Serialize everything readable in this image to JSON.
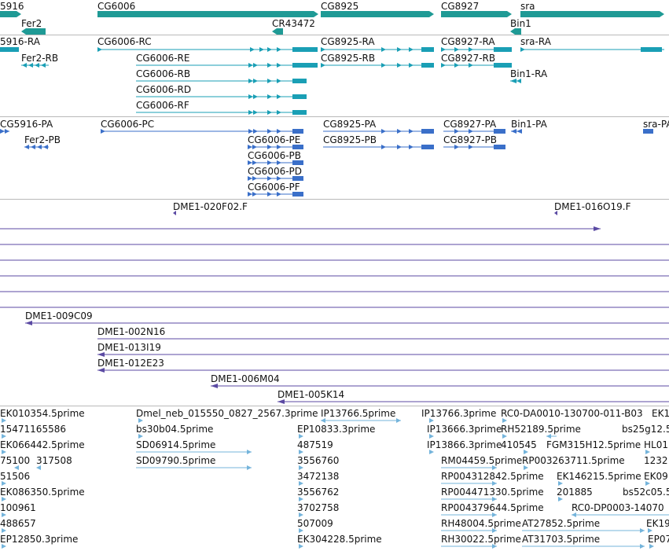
{
  "colors": {
    "gene": "#1f9a95",
    "transcript": "#1a9fb5",
    "protein": "#3a6fc9",
    "clone": "#5b4aa3",
    "est": "#74b4db",
    "separator": "#b9b9b9"
  },
  "tracks": {
    "genes": {
      "labels": [
        "5916",
        "Fer2",
        "CG6006",
        "CR43472",
        "CG8925",
        "CG8927",
        "Bin1",
        "sra"
      ]
    },
    "transcripts": {
      "labels": [
        "5916-RA",
        "Fer2-RB",
        "CG6006-RC",
        "CG6006-RE",
        "CG6006-RB",
        "CG6006-RD",
        "CG6006-RF",
        "CG8925-RA",
        "CG8925-RB",
        "CG8927-RA",
        "CG8927-RB",
        "sra-RA",
        "Bin1-RA"
      ]
    },
    "proteins": {
      "labels": [
        "CG5916-PA",
        "Fer2-PB",
        "CG6006-PC",
        "CG6006-PE",
        "CG6006-PB",
        "CG6006-PD",
        "CG6006-PF",
        "CG8925-PA",
        "CG8925-PB",
        "CG8927-PA",
        "CG8927-PB",
        "Bin1-PA",
        "sra-PA"
      ]
    },
    "clones": {
      "labels": [
        "DME1-020F02.F",
        "DME1-016O19.F",
        "DME1-009C09",
        "DME1-002N16",
        "DME1-013I19",
        "DME1-012E23",
        "DME1-006M04",
        "DME1-005K14"
      ]
    },
    "ests": {
      "labels": [
        "EK010354.5prime",
        "15471165586",
        "EK066442.5prime",
        "75100",
        "317508",
        "51506",
        "EK086350.5prime",
        "100961",
        "488657",
        "EP12850.3prime",
        "Dmel_neb_015550_0827_2567.3prime",
        "bs30b04.5prime",
        "SD06914.5prime",
        "SD09790.5prime",
        "IP13766.5prime",
        "EP10833.3prime",
        "487519",
        "3556760",
        "3472138",
        "3556762",
        "3702758",
        "507009",
        "EK304228.5prime",
        "IP13766.3prime",
        "IP13666.3prime",
        "IP13866.3prime",
        "RM04459.5prime",
        "RP004312842.5prime",
        "RP004471330.5prime",
        "RP004379644.5prime",
        "RH48004.5prime",
        "RH30022.5prime",
        "RC0-DA0010-130700-011-B03",
        "RH52189.5prime",
        "410545",
        "FGM315H12.5prime",
        "RP003263711.5prime",
        "EK146215.5prime",
        "201885",
        "RC0-DP0003-14070",
        "AT27852.5prime",
        "AT31703.5prime",
        "EK1",
        "bs25g12.5",
        "HL01",
        "1232",
        "EK09",
        "bs52c05.5",
        "EK19",
        "EP07"
      ]
    }
  }
}
